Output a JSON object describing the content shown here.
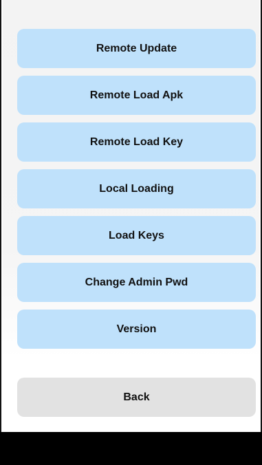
{
  "menu": {
    "items": [
      {
        "label": "Remote Update"
      },
      {
        "label": "Remote Load Apk"
      },
      {
        "label": "Remote Load Key"
      },
      {
        "label": "Local Loading"
      },
      {
        "label": "Load Keys"
      },
      {
        "label": "Change Admin Pwd"
      },
      {
        "label": "Version"
      }
    ],
    "back_label": "Back"
  },
  "colors": {
    "button_blue": "#bfe1fb",
    "button_gray": "#e2e2e2",
    "nav_bar": "#000000"
  }
}
